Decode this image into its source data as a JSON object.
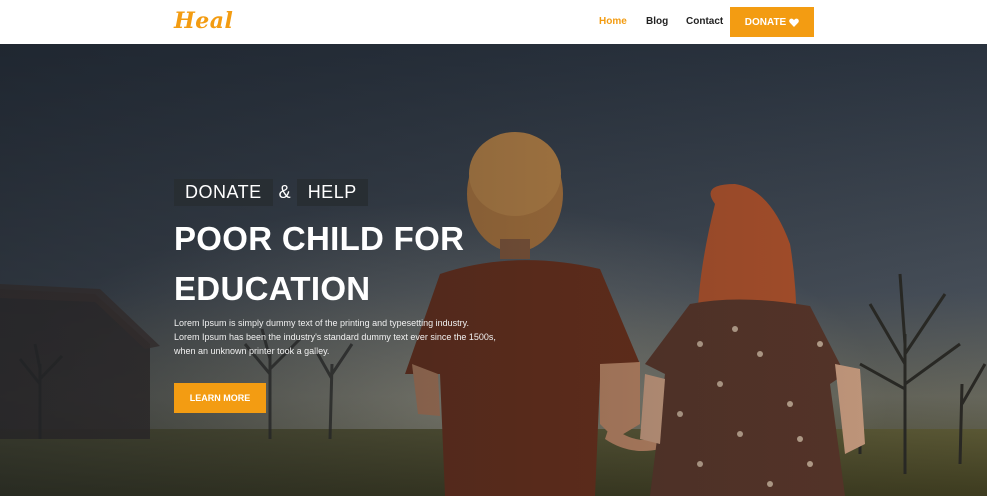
{
  "brand": {
    "logo_text": "Heal",
    "accent_color": "#f39c12"
  },
  "nav": {
    "items": [
      {
        "label": "Home",
        "active": true
      },
      {
        "label": "Blog",
        "active": false
      },
      {
        "label": "Contact",
        "active": false
      }
    ],
    "donate_label": "DONATE",
    "donate_icon": "heart-icon"
  },
  "hero": {
    "tag_left": "DONATE",
    "tag_amp": "&",
    "tag_right": "HELP",
    "headline_line1": "POOR CHILD FOR",
    "headline_line2": "EDUCATION",
    "desc_line1": "Lorem Ipsum is simply dummy text of the printing and typesetting industry.",
    "desc_line2": "Lorem Ipsum has been the industry's standard dummy text ever since the 1500s,",
    "desc_line3": "when an unknown printer took a galley.",
    "cta_label": "LEARN MORE",
    "background_image": "two children holding hands walking toward trees at dusk"
  }
}
